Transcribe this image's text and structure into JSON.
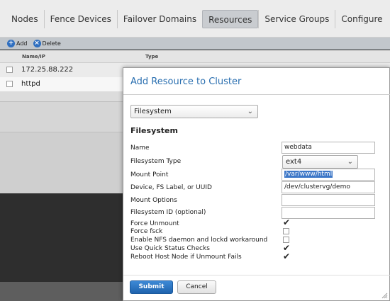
{
  "nav": {
    "tabs": [
      {
        "label": "Nodes"
      },
      {
        "label": "Fence Devices"
      },
      {
        "label": "Failover Domains"
      },
      {
        "label": "Resources",
        "active": true
      },
      {
        "label": "Service Groups"
      },
      {
        "label": "Configure"
      }
    ]
  },
  "toolbar": {
    "add_label": "Add",
    "delete_label": "Delete",
    "add_icon": "plus-circle-icon",
    "delete_icon": "x-circle-icon"
  },
  "table": {
    "columns": [
      "Name/IP",
      "Type"
    ],
    "rows": [
      {
        "name": "172.25.88.222"
      },
      {
        "name": "httpd"
      }
    ]
  },
  "modal": {
    "title": "Add Resource to Cluster",
    "resource_type": "Filesystem",
    "section_title": "Filesystem",
    "fields": {
      "name": {
        "label": "Name",
        "value": "webdata"
      },
      "fs_type": {
        "label": "Filesystem Type",
        "value": "ext4"
      },
      "mount_point": {
        "label": "Mount Point",
        "value": "/var/www/html"
      },
      "device": {
        "label": "Device, FS Label, or UUID",
        "value": "/dev/clustervg/demo"
      },
      "mount_options": {
        "label": "Mount Options",
        "value": ""
      },
      "fs_id": {
        "label": "Filesystem ID (optional)",
        "value": ""
      }
    },
    "checkboxes": {
      "force_unmount": {
        "label": "Force Unmount",
        "checked": true
      },
      "force_fsck": {
        "label": "Force fsck",
        "checked": false
      },
      "nfs_workaround": {
        "label": "Enable NFS daemon and lockd workaround",
        "checked": false
      },
      "quick_status": {
        "label": "Use Quick Status Checks",
        "checked": true
      },
      "reboot_host": {
        "label": "Reboot Host Node if Unmount Fails",
        "checked": true
      }
    },
    "submit_label": "Submit",
    "cancel_label": "Cancel"
  },
  "colors": {
    "accent": "#2a6fb0",
    "submit": "#2a72c0"
  }
}
